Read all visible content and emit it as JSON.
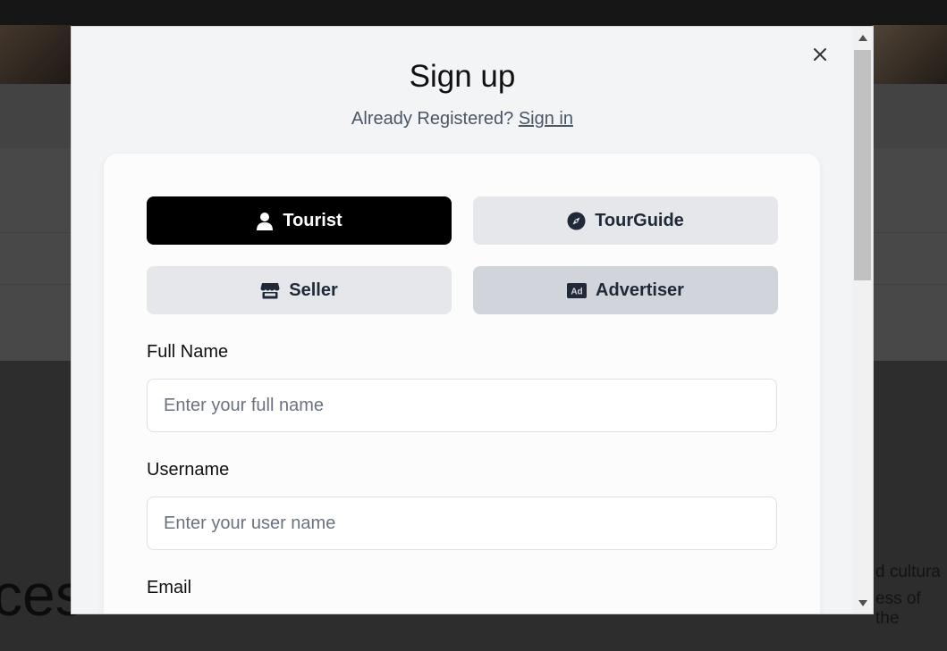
{
  "background": {
    "big_text": "ces",
    "right_lines": [
      "d cultura",
      "ess of the"
    ]
  },
  "modal": {
    "title": "Sign up",
    "subtitle_prefix": "Already Registered?",
    "signin_link": "Sign in",
    "close_icon": "close-icon",
    "roles": [
      {
        "label": "Tourist",
        "icon": "user-icon",
        "state": "active"
      },
      {
        "label": "TourGuide",
        "icon": "compass-icon",
        "state": "default"
      },
      {
        "label": "Seller",
        "icon": "store-icon",
        "state": "default"
      },
      {
        "label": "Advertiser",
        "icon": "ad-icon",
        "state": "hover"
      }
    ],
    "fields": {
      "full_name": {
        "label": "Full Name",
        "placeholder": "Enter your full name",
        "value": ""
      },
      "username": {
        "label": "Username",
        "placeholder": "Enter your user name",
        "value": ""
      },
      "email": {
        "label": "Email"
      }
    }
  },
  "colors": {
    "active_role_bg": "#000000",
    "role_bg": "#e5e7eb",
    "role_hover_bg": "#d1d5db",
    "modal_bg": "#f3f4f6"
  }
}
